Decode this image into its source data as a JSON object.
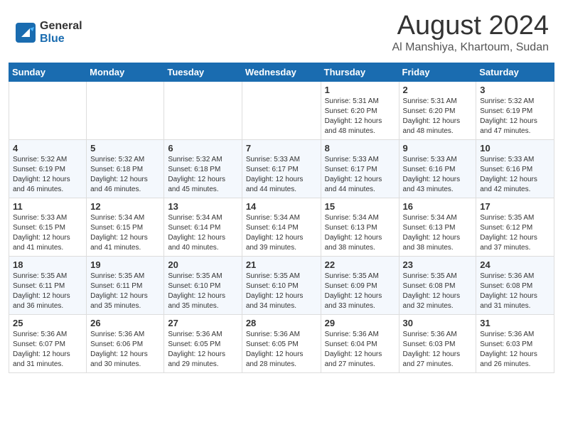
{
  "header": {
    "logo_general": "General",
    "logo_blue": "Blue",
    "month_year": "August 2024",
    "location": "Al Manshiya, Khartoum, Sudan"
  },
  "days_of_week": [
    "Sunday",
    "Monday",
    "Tuesday",
    "Wednesday",
    "Thursday",
    "Friday",
    "Saturday"
  ],
  "weeks": [
    [
      {
        "day": "",
        "info": ""
      },
      {
        "day": "",
        "info": ""
      },
      {
        "day": "",
        "info": ""
      },
      {
        "day": "",
        "info": ""
      },
      {
        "day": "1",
        "info": "Sunrise: 5:31 AM\nSunset: 6:20 PM\nDaylight: 12 hours\nand 48 minutes."
      },
      {
        "day": "2",
        "info": "Sunrise: 5:31 AM\nSunset: 6:20 PM\nDaylight: 12 hours\nand 48 minutes."
      },
      {
        "day": "3",
        "info": "Sunrise: 5:32 AM\nSunset: 6:19 PM\nDaylight: 12 hours\nand 47 minutes."
      }
    ],
    [
      {
        "day": "4",
        "info": "Sunrise: 5:32 AM\nSunset: 6:19 PM\nDaylight: 12 hours\nand 46 minutes."
      },
      {
        "day": "5",
        "info": "Sunrise: 5:32 AM\nSunset: 6:18 PM\nDaylight: 12 hours\nand 46 minutes."
      },
      {
        "day": "6",
        "info": "Sunrise: 5:32 AM\nSunset: 6:18 PM\nDaylight: 12 hours\nand 45 minutes."
      },
      {
        "day": "7",
        "info": "Sunrise: 5:33 AM\nSunset: 6:17 PM\nDaylight: 12 hours\nand 44 minutes."
      },
      {
        "day": "8",
        "info": "Sunrise: 5:33 AM\nSunset: 6:17 PM\nDaylight: 12 hours\nand 44 minutes."
      },
      {
        "day": "9",
        "info": "Sunrise: 5:33 AM\nSunset: 6:16 PM\nDaylight: 12 hours\nand 43 minutes."
      },
      {
        "day": "10",
        "info": "Sunrise: 5:33 AM\nSunset: 6:16 PM\nDaylight: 12 hours\nand 42 minutes."
      }
    ],
    [
      {
        "day": "11",
        "info": "Sunrise: 5:33 AM\nSunset: 6:15 PM\nDaylight: 12 hours\nand 41 minutes."
      },
      {
        "day": "12",
        "info": "Sunrise: 5:34 AM\nSunset: 6:15 PM\nDaylight: 12 hours\nand 41 minutes."
      },
      {
        "day": "13",
        "info": "Sunrise: 5:34 AM\nSunset: 6:14 PM\nDaylight: 12 hours\nand 40 minutes."
      },
      {
        "day": "14",
        "info": "Sunrise: 5:34 AM\nSunset: 6:14 PM\nDaylight: 12 hours\nand 39 minutes."
      },
      {
        "day": "15",
        "info": "Sunrise: 5:34 AM\nSunset: 6:13 PM\nDaylight: 12 hours\nand 38 minutes."
      },
      {
        "day": "16",
        "info": "Sunrise: 5:34 AM\nSunset: 6:13 PM\nDaylight: 12 hours\nand 38 minutes."
      },
      {
        "day": "17",
        "info": "Sunrise: 5:35 AM\nSunset: 6:12 PM\nDaylight: 12 hours\nand 37 minutes."
      }
    ],
    [
      {
        "day": "18",
        "info": "Sunrise: 5:35 AM\nSunset: 6:11 PM\nDaylight: 12 hours\nand 36 minutes."
      },
      {
        "day": "19",
        "info": "Sunrise: 5:35 AM\nSunset: 6:11 PM\nDaylight: 12 hours\nand 35 minutes."
      },
      {
        "day": "20",
        "info": "Sunrise: 5:35 AM\nSunset: 6:10 PM\nDaylight: 12 hours\nand 35 minutes."
      },
      {
        "day": "21",
        "info": "Sunrise: 5:35 AM\nSunset: 6:10 PM\nDaylight: 12 hours\nand 34 minutes."
      },
      {
        "day": "22",
        "info": "Sunrise: 5:35 AM\nSunset: 6:09 PM\nDaylight: 12 hours\nand 33 minutes."
      },
      {
        "day": "23",
        "info": "Sunrise: 5:35 AM\nSunset: 6:08 PM\nDaylight: 12 hours\nand 32 minutes."
      },
      {
        "day": "24",
        "info": "Sunrise: 5:36 AM\nSunset: 6:08 PM\nDaylight: 12 hours\nand 31 minutes."
      }
    ],
    [
      {
        "day": "25",
        "info": "Sunrise: 5:36 AM\nSunset: 6:07 PM\nDaylight: 12 hours\nand 31 minutes."
      },
      {
        "day": "26",
        "info": "Sunrise: 5:36 AM\nSunset: 6:06 PM\nDaylight: 12 hours\nand 30 minutes."
      },
      {
        "day": "27",
        "info": "Sunrise: 5:36 AM\nSunset: 6:05 PM\nDaylight: 12 hours\nand 29 minutes."
      },
      {
        "day": "28",
        "info": "Sunrise: 5:36 AM\nSunset: 6:05 PM\nDaylight: 12 hours\nand 28 minutes."
      },
      {
        "day": "29",
        "info": "Sunrise: 5:36 AM\nSunset: 6:04 PM\nDaylight: 12 hours\nand 27 minutes."
      },
      {
        "day": "30",
        "info": "Sunrise: 5:36 AM\nSunset: 6:03 PM\nDaylight: 12 hours\nand 27 minutes."
      },
      {
        "day": "31",
        "info": "Sunrise: 5:36 AM\nSunset: 6:03 PM\nDaylight: 12 hours\nand 26 minutes."
      }
    ]
  ]
}
